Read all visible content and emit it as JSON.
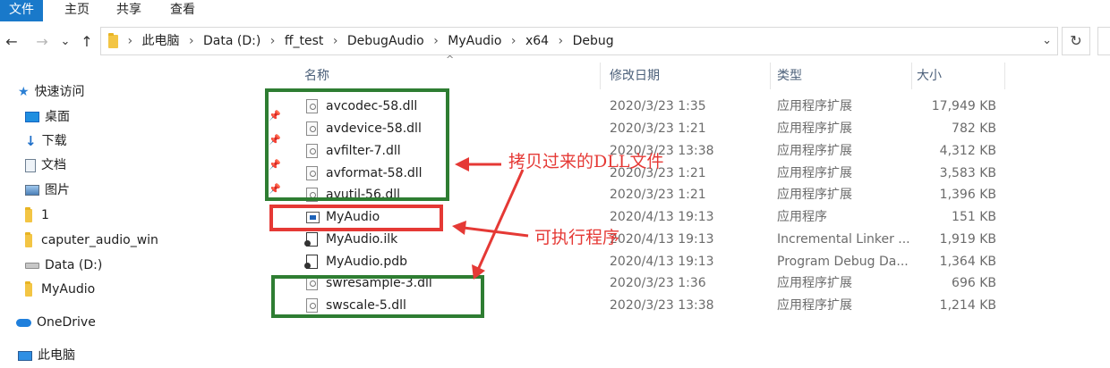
{
  "ribbon": {
    "tabs": [
      {
        "label": "文件",
        "active": true
      },
      {
        "label": "主页",
        "active": false
      },
      {
        "label": "共享",
        "active": false
      },
      {
        "label": "查看",
        "active": false
      }
    ]
  },
  "nav": {
    "back": "←",
    "forward": "→",
    "recent": "⌄",
    "up": "↑",
    "refresh": "↻",
    "dropdown": "⌄"
  },
  "address": {
    "crumbs": [
      "此电脑",
      "Data (D:)",
      "ff_test",
      "DebugAudio",
      "MyAudio",
      "x64",
      "Debug"
    ],
    "separator": "›"
  },
  "sidebar": {
    "items": [
      {
        "label": "快速访问",
        "icon": "star-icon"
      },
      {
        "label": "桌面",
        "icon": "desktop-icon"
      },
      {
        "label": "下载",
        "icon": "download-icon"
      },
      {
        "label": "文档",
        "icon": "document-icon"
      },
      {
        "label": "图片",
        "icon": "pictures-icon"
      },
      {
        "label": "1",
        "icon": "folder-icon"
      },
      {
        "label": "caputer_audio_win",
        "icon": "folder-icon"
      },
      {
        "label": "Data (D:)",
        "icon": "drive-icon"
      },
      {
        "label": "MyAudio",
        "icon": "folder-icon"
      },
      {
        "label": "OneDrive",
        "icon": "cloud-icon"
      },
      {
        "label": "此电脑",
        "icon": "computer-icon"
      }
    ]
  },
  "columns": {
    "name": "名称",
    "date": "修改日期",
    "type": "类型",
    "size": "大小",
    "sort_indicator": "^"
  },
  "files": [
    {
      "name": "avcodec-58.dll",
      "date": "2020/3/23 1:35",
      "type": "应用程序扩展",
      "size": "17,949 KB",
      "icon": "dll-file-icon"
    },
    {
      "name": "avdevice-58.dll",
      "date": "2020/3/23 1:21",
      "type": "应用程序扩展",
      "size": "782 KB",
      "icon": "dll-file-icon"
    },
    {
      "name": "avfilter-7.dll",
      "date": "2020/3/23 13:38",
      "type": "应用程序扩展",
      "size": "4,312 KB",
      "icon": "dll-file-icon"
    },
    {
      "name": "avformat-58.dll",
      "date": "2020/3/23 1:21",
      "type": "应用程序扩展",
      "size": "3,583 KB",
      "icon": "dll-file-icon"
    },
    {
      "name": "avutil-56.dll",
      "date": "2020/3/23 1:21",
      "type": "应用程序扩展",
      "size": "1,396 KB",
      "icon": "dll-file-icon"
    },
    {
      "name": "MyAudio",
      "date": "2020/4/13 19:13",
      "type": "应用程序",
      "size": "151 KB",
      "icon": "exe-file-icon"
    },
    {
      "name": "MyAudio.ilk",
      "date": "2020/4/13 19:13",
      "type": "Incremental Linker ...",
      "size": "1,919 KB",
      "icon": "ilk-file-icon"
    },
    {
      "name": "MyAudio.pdb",
      "date": "2020/4/13 19:13",
      "type": "Program Debug Da...",
      "size": "1,364 KB",
      "icon": "pdb-file-icon"
    },
    {
      "name": "swresample-3.dll",
      "date": "2020/3/23 1:36",
      "type": "应用程序扩展",
      "size": "696 KB",
      "icon": "dll-file-icon"
    },
    {
      "name": "swscale-5.dll",
      "date": "2020/3/23 13:38",
      "type": "应用程序扩展",
      "size": "1,214 KB",
      "icon": "dll-file-icon"
    }
  ],
  "annotations": {
    "dll_label": "拷贝过来的DLL文件",
    "exe_label": "可执行程序"
  },
  "colors": {
    "accent": "#1979ca",
    "annotation_red": "#e53935",
    "annotation_green": "#2e7d32"
  }
}
